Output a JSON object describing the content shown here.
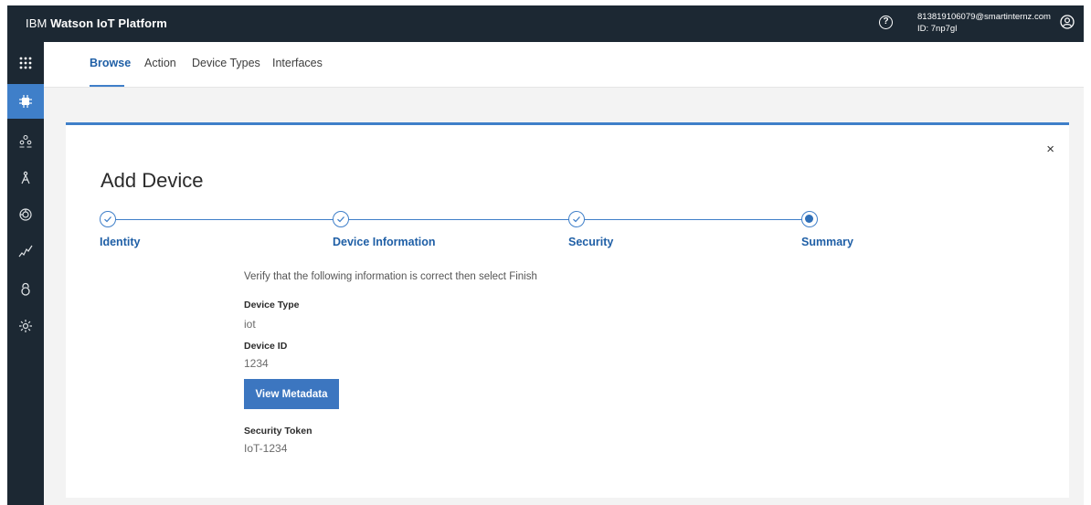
{
  "header": {
    "brand_prefix": "IBM",
    "brand_name": "Watson IoT Platform",
    "help_glyph": "?",
    "user_email": "813819106079@smartinternz.com",
    "user_id": "ID: 7np7gl"
  },
  "rail": {
    "items": [
      {
        "name": "apps-grid-icon",
        "glyph": "⠿"
      },
      {
        "name": "devices-chip-icon",
        "glyph": "⬢"
      },
      {
        "name": "members-icon",
        "glyph": "ꙮ"
      },
      {
        "name": "apps-icon",
        "glyph": "A"
      },
      {
        "name": "rules-icon",
        "glyph": "⚙"
      },
      {
        "name": "usage-chart-icon",
        "glyph": "〰"
      },
      {
        "name": "security-icon",
        "glyph": "ə"
      },
      {
        "name": "settings-icon",
        "glyph": "⚙"
      }
    ]
  },
  "subnav": {
    "tabs": [
      "Browse",
      "Action",
      "Device Types",
      "Interfaces"
    ]
  },
  "modal": {
    "close_glyph": "×",
    "title": "Add Device",
    "steps": [
      "Identity",
      "Device Information",
      "Security",
      "Summary"
    ],
    "verify_text": "Verify that the following information is correct then select Finish",
    "device_type_label": "Device Type",
    "device_type_value": "iot",
    "device_id_label": "Device ID",
    "device_id_value": "1234",
    "view_metadata_label": "View Metadata",
    "security_token_label": "Security Token",
    "security_token_value": "IoT-1234"
  },
  "colors": {
    "topbar": "#1c2833",
    "accent": "#3f7fc9",
    "button": "#3c76c0"
  }
}
